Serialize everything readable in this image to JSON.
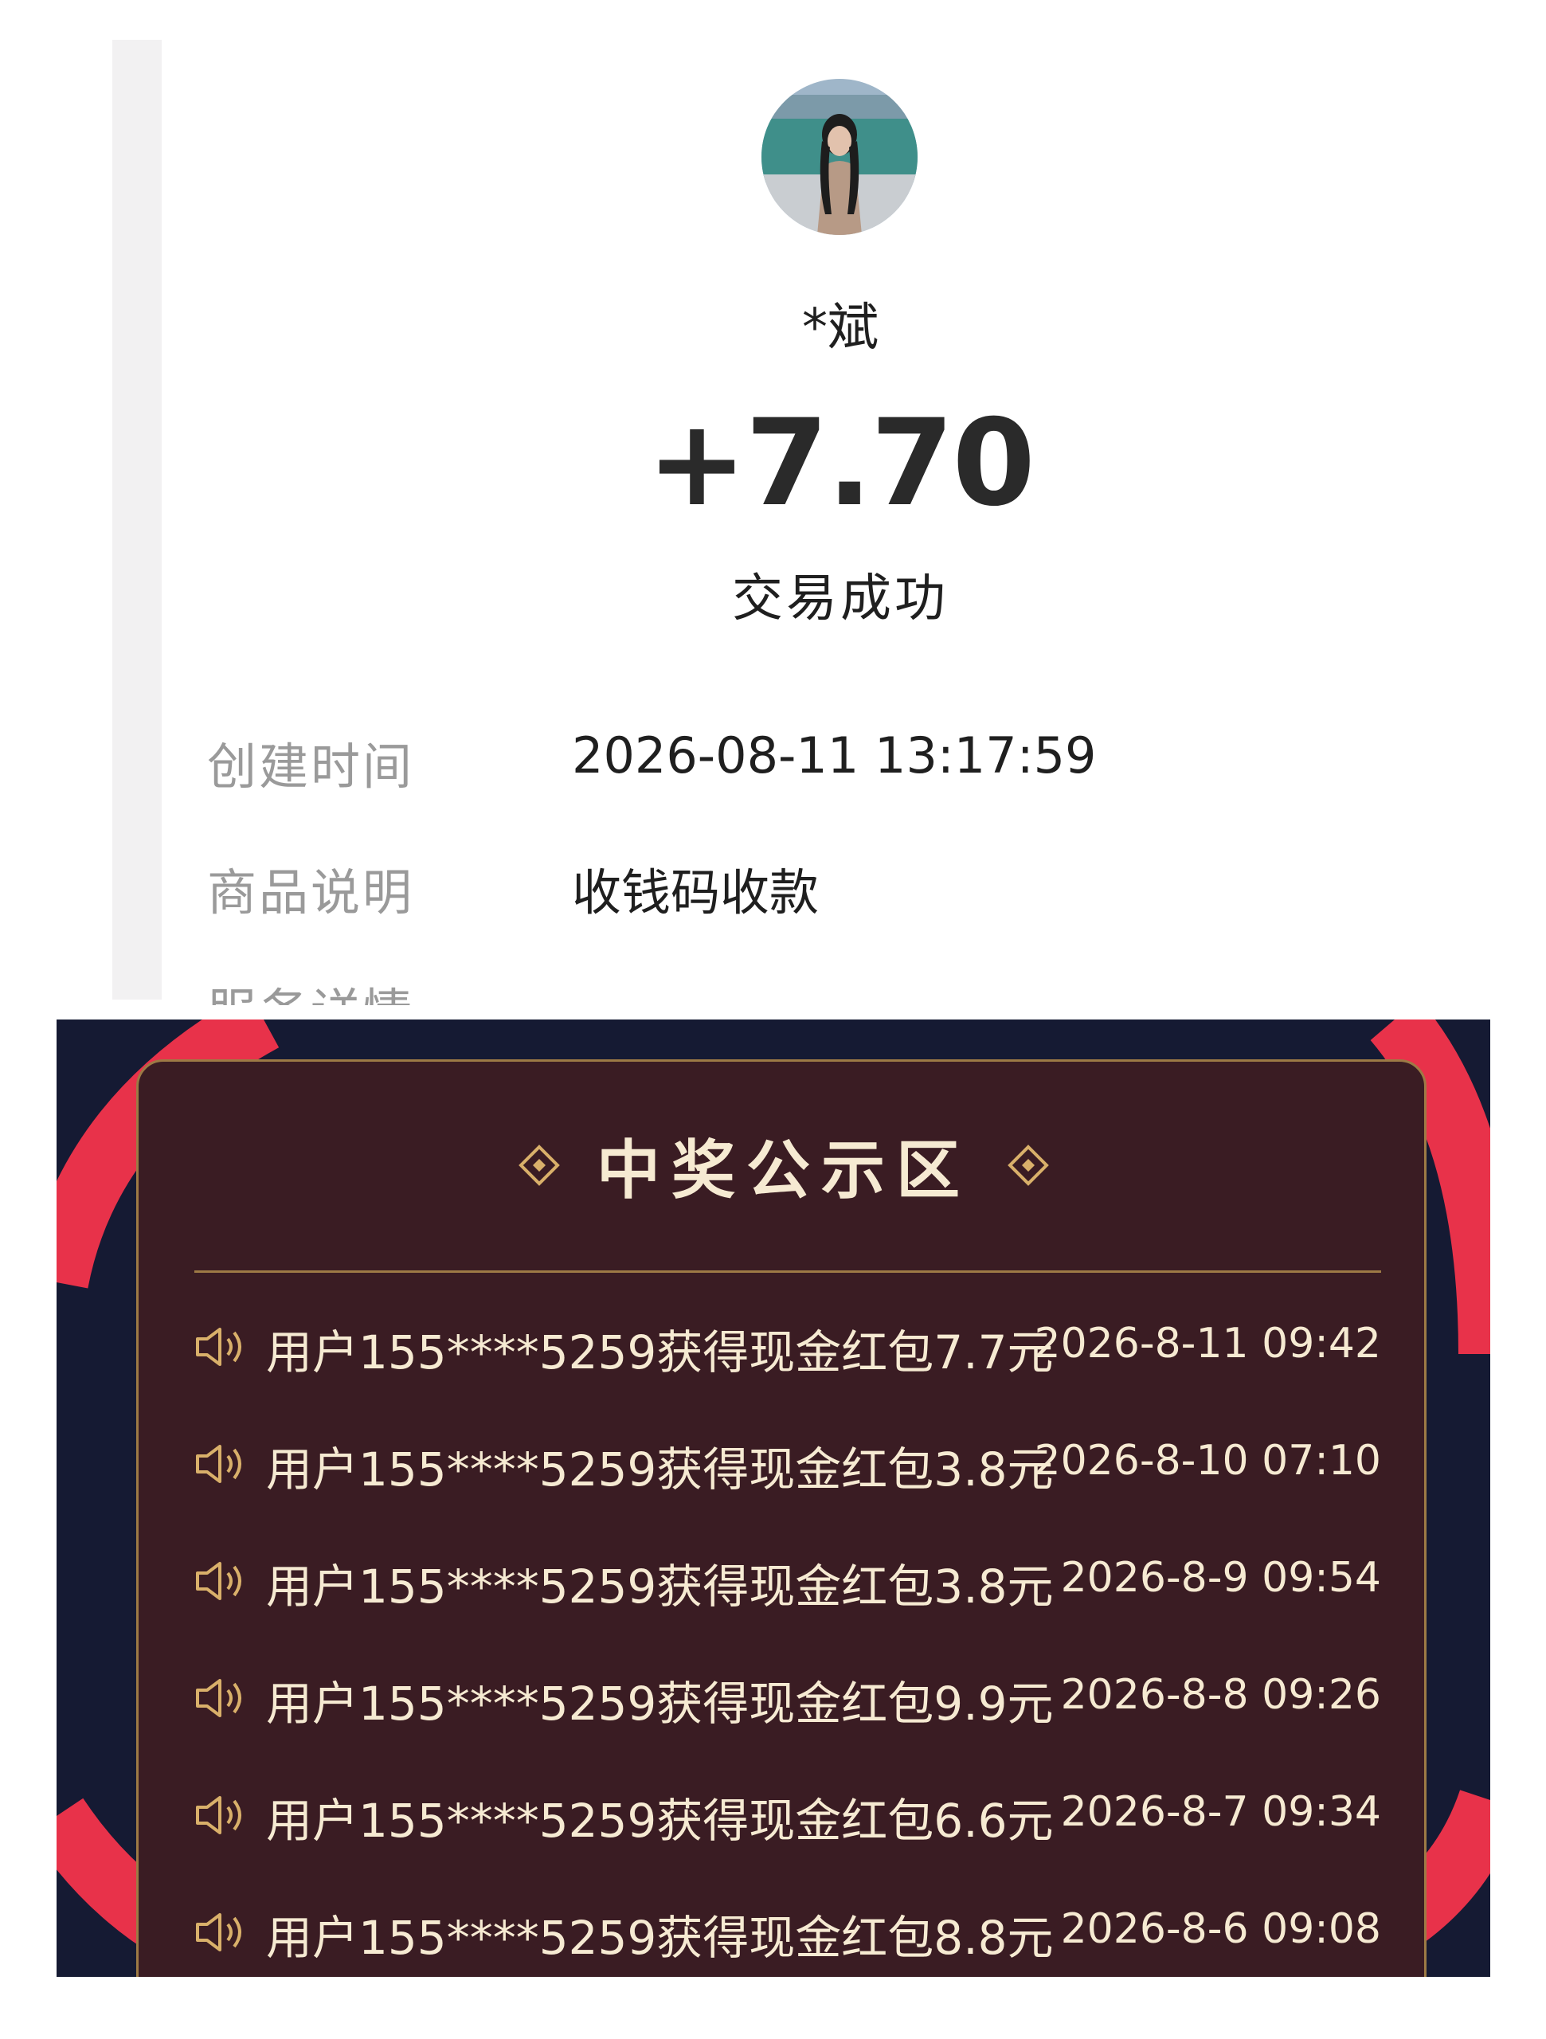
{
  "receipt": {
    "payer_name": "*斌",
    "amount": "+7.70",
    "status": "交易成功",
    "details": [
      {
        "label": "创建时间",
        "value": "2026-08-11 13:17:59"
      },
      {
        "label": "商品说明",
        "value": "收钱码收款"
      }
    ],
    "cut_off_label": "服务详情"
  },
  "board": {
    "title": "中奖公示区",
    "entries": [
      {
        "text": "用户155****5259获得现金红包7.7元",
        "time": "2026-8-11 09:42"
      },
      {
        "text": "用户155****5259获得现金红包3.8元",
        "time": "2026-8-10 07:10"
      },
      {
        "text": "用户155****5259获得现金红包3.8元",
        "time": "2026-8-9 09:54"
      },
      {
        "text": "用户155****5259获得现金红包9.9元",
        "time": "2026-8-8 09:26"
      },
      {
        "text": "用户155****5259获得现金红包6.6元",
        "time": "2026-8-7 09:34"
      },
      {
        "text": "用户155****5259获得现金红包8.8元",
        "time": "2026-8-6 09:08"
      }
    ]
  },
  "icons": {
    "avatar": "avatar-photo",
    "title_decoration": "diamond-icon",
    "entry_icon": "speaker-icon"
  },
  "colors": {
    "board_background": "#3a1c23",
    "board_border": "#9d7a45",
    "board_text": "#f6ead2",
    "outer_background": "#151a33",
    "highlight_circle": "#e8324a"
  }
}
